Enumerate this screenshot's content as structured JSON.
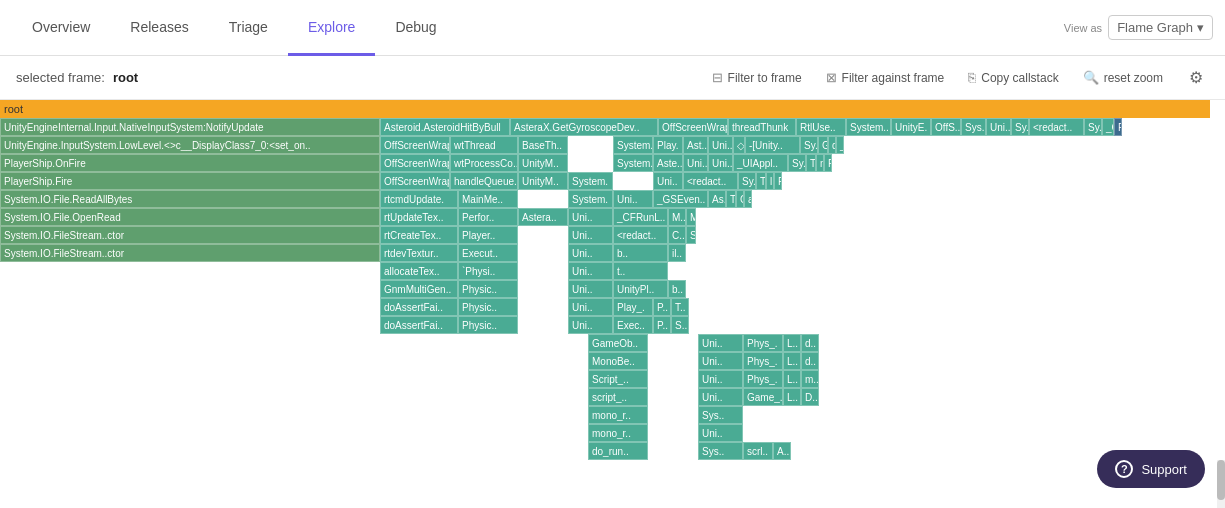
{
  "nav": {
    "tabs": [
      {
        "label": "Overview",
        "id": "overview",
        "active": false
      },
      {
        "label": "Releases",
        "id": "releases",
        "active": false
      },
      {
        "label": "Triage",
        "id": "triage",
        "active": false
      },
      {
        "label": "Explore",
        "id": "explore",
        "active": true
      },
      {
        "label": "Debug",
        "id": "debug",
        "active": false
      }
    ],
    "view_as_label": "View as",
    "view_as_value": "Flame Graph"
  },
  "toolbar": {
    "selected_frame_label": "selected frame:",
    "selected_frame_value": "root",
    "filter_to_frame": "Filter to frame",
    "filter_against_frame": "Filter against frame",
    "copy_callstack": "Copy callstack",
    "reset_zoom": "reset zoom"
  },
  "support": {
    "label": "Support"
  }
}
